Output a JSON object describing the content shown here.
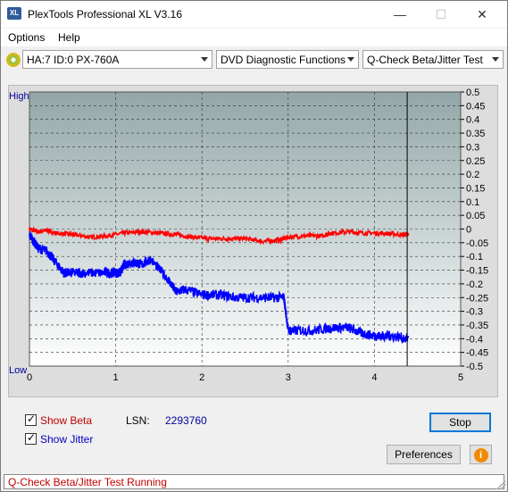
{
  "window": {
    "title": "PlexTools Professional XL V3.16",
    "icon": "XL",
    "minimize_glyph": "—",
    "maximize_glyph": "☐",
    "close_glyph": "✕"
  },
  "menu": {
    "options": "Options",
    "help": "Help"
  },
  "toolbar": {
    "drive": "HA:7 ID:0  PX-760A",
    "function": "DVD Diagnostic Functions",
    "test": "Q-Check Beta/Jitter Test"
  },
  "chart_data": {
    "type": "line",
    "left_labels": {
      "top": "High",
      "bottom": "Low"
    },
    "x_ticks": [
      "0",
      "1",
      "2",
      "3",
      "4",
      "5"
    ],
    "xlim": [
      0,
      5
    ],
    "y_ticks": [
      "0.5",
      "0.45",
      "0.4",
      "0.35",
      "0.3",
      "0.25",
      "0.2",
      "0.15",
      "0.1",
      "0.05",
      "0",
      "-0.05",
      "-0.1",
      "-0.15",
      "-0.2",
      "-0.25",
      "-0.3",
      "-0.35",
      "-0.4",
      "-0.45",
      "-0.5"
    ],
    "ylim": [
      -0.5,
      0.5
    ],
    "grid": true,
    "cursor_x": 4.38,
    "series": [
      {
        "color": "#ff0000",
        "x": [
          0,
          0.1,
          0.2,
          0.3,
          0.5,
          0.7,
          0.9,
          1.1,
          1.3,
          1.5,
          1.7,
          1.9,
          2.1,
          2.3,
          2.5,
          2.7,
          2.9,
          3.0,
          3.2,
          3.4,
          3.5,
          3.7,
          3.9,
          4.1,
          4.3,
          4.4
        ],
        "y": [
          0.0,
          -0.01,
          -0.005,
          -0.015,
          -0.02,
          -0.03,
          -0.025,
          -0.015,
          -0.01,
          -0.015,
          -0.02,
          -0.03,
          -0.035,
          -0.035,
          -0.035,
          -0.045,
          -0.04,
          -0.03,
          -0.025,
          -0.025,
          -0.015,
          -0.01,
          -0.015,
          -0.015,
          -0.02,
          -0.02
        ]
      },
      {
        "color": "#0000ff",
        "x": [
          0,
          0.1,
          0.2,
          0.3,
          0.4,
          0.5,
          0.7,
          0.9,
          1.0,
          1.05,
          1.1,
          1.2,
          1.3,
          1.4,
          1.6,
          1.7,
          1.8,
          2.0,
          2.2,
          2.4,
          2.6,
          2.8,
          2.95,
          3.0,
          3.1,
          3.3,
          3.5,
          3.7,
          3.85,
          4.0,
          4.1,
          4.2,
          4.4
        ],
        "y": [
          -0.02,
          -0.07,
          -0.08,
          -0.12,
          -0.16,
          -0.16,
          -0.16,
          -0.16,
          -0.16,
          -0.16,
          -0.13,
          -0.12,
          -0.13,
          -0.11,
          -0.18,
          -0.23,
          -0.22,
          -0.24,
          -0.24,
          -0.25,
          -0.25,
          -0.25,
          -0.25,
          -0.37,
          -0.37,
          -0.37,
          -0.36,
          -0.36,
          -0.38,
          -0.39,
          -0.39,
          -0.39,
          -0.4
        ]
      }
    ]
  },
  "controls": {
    "show_beta": "Show Beta",
    "show_jitter": "Show Jitter",
    "lsn_label": "LSN:",
    "lsn_value": "2293760",
    "stop_button": "Stop",
    "preferences_button": "Preferences",
    "info_button": "i"
  },
  "status": "Q-Check Beta/Jitter Test Running"
}
